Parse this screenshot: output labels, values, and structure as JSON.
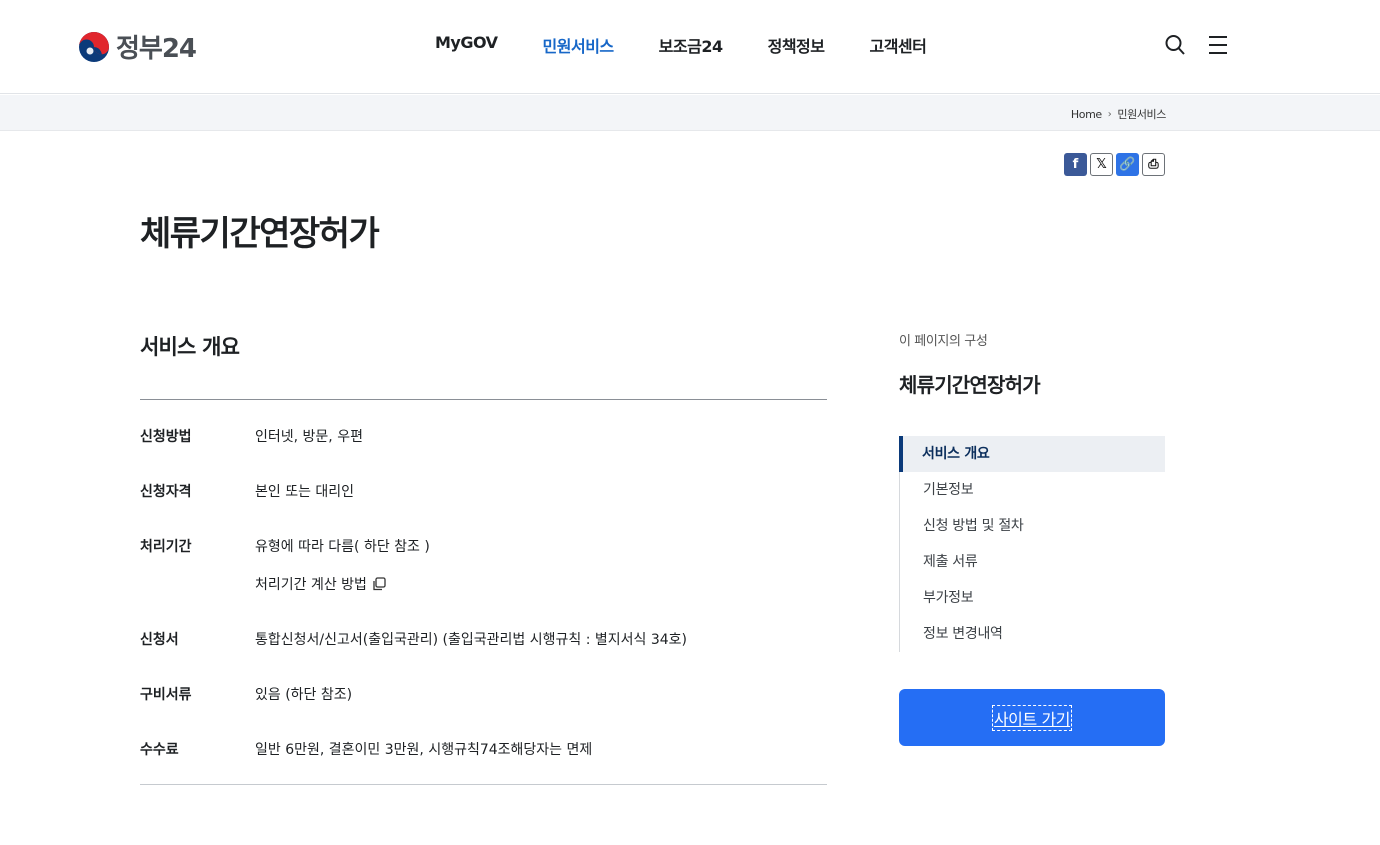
{
  "header": {
    "logo_text": "정부24",
    "nav": [
      {
        "label": "MyGOV",
        "active": false
      },
      {
        "label": "민원서비스",
        "active": true
      },
      {
        "label": "보조금24",
        "active": false
      },
      {
        "label": "정책정보",
        "active": false
      },
      {
        "label": "고객센터",
        "active": false
      }
    ],
    "search_icon": "search-icon",
    "menu_icon": "hamburger-menu-icon"
  },
  "breadcrumb": {
    "home": "Home",
    "current": "민원서비스"
  },
  "share": {
    "facebook_icon": "f",
    "x_icon": "𝕏",
    "link_icon": "🔗",
    "print_icon": "⎙"
  },
  "page_title": "체류기간연장허가",
  "overview": {
    "title": "서비스 개요",
    "rows": [
      {
        "label": "신청방법",
        "value": "인터넷, 방문, 우편"
      },
      {
        "label": "신청자격",
        "value": "본인 또는 대리인"
      },
      {
        "label": "처리기간",
        "value": "유형에 따라 다름( 하단 참조 )",
        "link": "처리기간 계산 방법"
      },
      {
        "label": "신청서",
        "value": "통합신청서/신고서(출입국관리) (출입국관리법 시행규칙 : 별지서식 34호)"
      },
      {
        "label": "구비서류",
        "value": "있음 (하단 참조)"
      },
      {
        "label": "수수료",
        "value": "일반 6만원, 결혼이민 3만원, 시행규칙74조해당자는 면제"
      }
    ]
  },
  "aside": {
    "caption": "이 페이지의 구성",
    "title": "체류기간연장허가",
    "toc": [
      "서비스 개요",
      "기본정보",
      "신청 방법 및 절차",
      "제출 서류",
      "부가정보",
      "정보 변경내역"
    ],
    "button": "사이트 가기"
  },
  "colors": {
    "brand": "#256ef4",
    "nav_active": "#1767c8",
    "toc_active": "#0b3a7a"
  }
}
